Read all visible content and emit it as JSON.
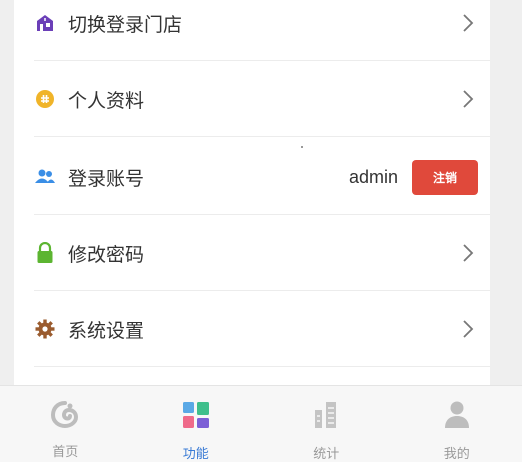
{
  "menu": {
    "items": [
      {
        "label": "切换登录门店",
        "icon": "store-icon"
      },
      {
        "label": "个人资料",
        "icon": "profile-icon"
      },
      {
        "label": "登录账号",
        "icon": "account-icon",
        "value": "admin",
        "button": "注销"
      },
      {
        "label": "修改密码",
        "icon": "lock-icon"
      },
      {
        "label": "系统设置",
        "icon": "gear-icon"
      }
    ]
  },
  "tabbar": {
    "tabs": [
      {
        "label": "首页",
        "icon": "home-icon",
        "active": false
      },
      {
        "label": "功能",
        "icon": "function-icon",
        "active": true
      },
      {
        "label": "统计",
        "icon": "statistics-icon",
        "active": false
      },
      {
        "label": "我的",
        "icon": "user-icon",
        "active": false
      }
    ]
  },
  "colors": {
    "accent": "#3a7bd5",
    "danger": "#e0493b",
    "store_icon": "#6b3fb8",
    "profile_icon": "#f0b429",
    "account_icon": "#3a8ee6",
    "lock_icon": "#5cb531",
    "gear_icon": "#9a5b2e"
  }
}
